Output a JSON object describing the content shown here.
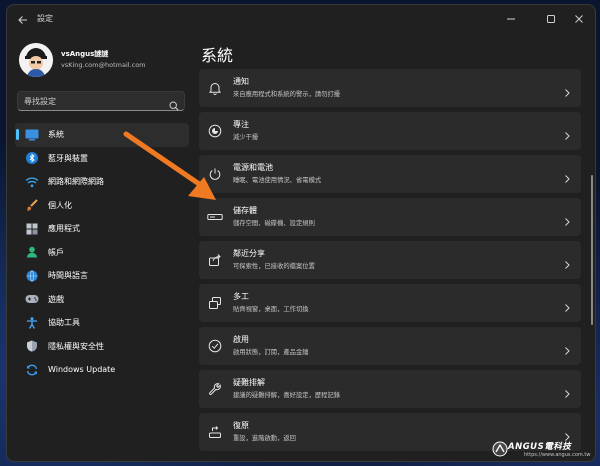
{
  "app": {
    "title": "設定"
  },
  "profile": {
    "name": "vsAngus謎謎",
    "email": "vsKing.com@hotmail.com"
  },
  "search": {
    "placeholder": "尋找設定"
  },
  "sidebar": {
    "items": [
      {
        "label": "系統",
        "icon": "monitor-icon",
        "active": true
      },
      {
        "label": "藍牙與裝置",
        "icon": "bluetooth-icon"
      },
      {
        "label": "網路和網際網路",
        "icon": "wifi-icon"
      },
      {
        "label": "個人化",
        "icon": "brush-icon"
      },
      {
        "label": "應用程式",
        "icon": "apps-icon"
      },
      {
        "label": "帳戶",
        "icon": "person-icon"
      },
      {
        "label": "時間與語言",
        "icon": "globe-clock-icon"
      },
      {
        "label": "遊戲",
        "icon": "gamepad-icon"
      },
      {
        "label": "協助工具",
        "icon": "accessibility-icon"
      },
      {
        "label": "隱私權與安全性",
        "icon": "shield-icon"
      },
      {
        "label": "Windows Update",
        "icon": "windows-update-icon"
      }
    ]
  },
  "main": {
    "title": "系統",
    "cards": [
      {
        "title": "通知",
        "desc": "來自應用程式和系統的警示，請勿打擾",
        "icon": "bell-icon"
      },
      {
        "title": "專注",
        "desc": "減少干擾",
        "icon": "focus-icon"
      },
      {
        "title": "電源和電池",
        "desc": "睡眠、電池使用情況、省電模式",
        "icon": "power-icon"
      },
      {
        "title": "儲存體",
        "desc": "儲存空間、磁碟機、設定規則",
        "icon": "storage-icon"
      },
      {
        "title": "鄰近分享",
        "desc": "可探索性，已接收的檔案位置",
        "icon": "share-icon"
      },
      {
        "title": "多工",
        "desc": "貼齊視窗，桌面，工作切換",
        "icon": "multitask-icon"
      },
      {
        "title": "啟用",
        "desc": "啟用狀態，訂閱，產品金鑰",
        "icon": "check-circle-icon"
      },
      {
        "title": "疑難排解",
        "desc": "建議的疑難排解，喜好設定，歷程記錄",
        "icon": "wrench-icon"
      },
      {
        "title": "復原",
        "desc": "重設，進階啟動，返回",
        "icon": "recovery-icon"
      }
    ]
  },
  "watermark": {
    "title": "ANGUS電科技",
    "url": "https://www.angus.com.tw"
  },
  "colors": {
    "accent": "#4cc2ff",
    "annotation_arrow": "#f07a22"
  }
}
